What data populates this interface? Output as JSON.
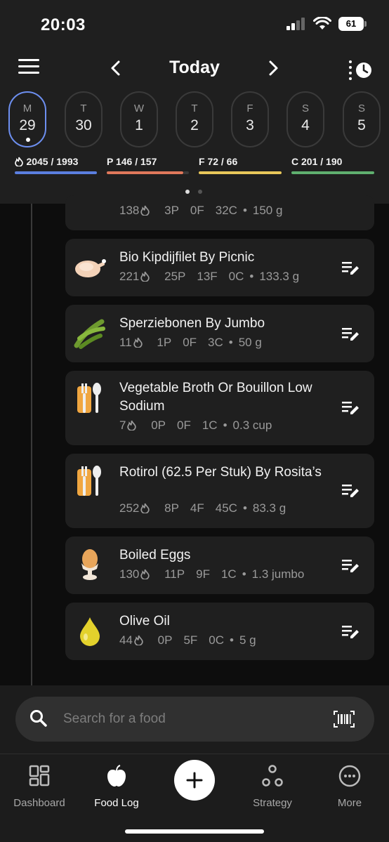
{
  "status": {
    "time": "20:03",
    "battery": "61"
  },
  "header": {
    "title": "Today"
  },
  "week": [
    {
      "letter": "M",
      "num": "29",
      "selected": true
    },
    {
      "letter": "T",
      "num": "30"
    },
    {
      "letter": "W",
      "num": "1"
    },
    {
      "letter": "T",
      "num": "2"
    },
    {
      "letter": "F",
      "num": "3"
    },
    {
      "letter": "S",
      "num": "4"
    },
    {
      "letter": "S",
      "num": "5"
    }
  ],
  "macros": {
    "calories": {
      "text": "2045 / 1993",
      "color": "#5b7fe0"
    },
    "protein": {
      "text": "P 146 / 157",
      "color": "#e0785b"
    },
    "fat": {
      "text": "F 72 / 66",
      "color": "#e8c75a"
    },
    "carbs": {
      "text": "C 201 / 190",
      "color": "#5fb06f"
    }
  },
  "entries": [
    {
      "name": "",
      "cal": "138",
      "p": "3P",
      "f": "0F",
      "c": "32C",
      "amount": "150 g"
    },
    {
      "name": "Bio Kipdijfilet By Picnic",
      "cal": "221",
      "p": "25P",
      "f": "13F",
      "c": "0C",
      "amount": "133.3 g",
      "icon": "chicken-icon"
    },
    {
      "name": "Sperziebonen By Jumbo",
      "cal": "11",
      "p": "1P",
      "f": "0F",
      "c": "3C",
      "amount": "50 g",
      "icon": "green-beans-icon"
    },
    {
      "name": "Vegetable Broth Or Bouillon Low Sodium",
      "cal": "7",
      "p": "0P",
      "f": "0F",
      "c": "1C",
      "amount": "0.3 cup",
      "icon": "utensils-icon"
    },
    {
      "name": "Rotirol (62.5 Per Stuk) By Rosita’s",
      "cal": "252",
      "p": "8P",
      "f": "4F",
      "c": "45C",
      "amount": "83.3 g",
      "icon": "utensils-icon"
    },
    {
      "name": "Boiled Eggs",
      "cal": "130",
      "p": "11P",
      "f": "9F",
      "c": "1C",
      "amount": "1.3 jumbo",
      "icon": "egg-icon"
    },
    {
      "name": "Olive Oil",
      "cal": "44",
      "p": "0P",
      "f": "5F",
      "c": "0C",
      "amount": "5 g",
      "icon": "oil-drop-icon"
    }
  ],
  "search": {
    "placeholder": "Search for a food"
  },
  "tabs": {
    "dashboard": "Dashboard",
    "food_log": "Food Log",
    "strategy": "Strategy",
    "more": "More"
  }
}
